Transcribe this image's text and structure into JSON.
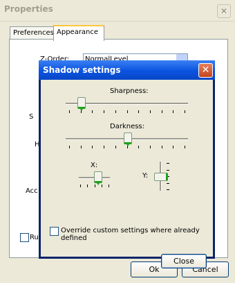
{
  "window": {
    "title": "Properties",
    "close_symbol": "✕"
  },
  "tabs": [
    {
      "label": "Preferences"
    },
    {
      "label": "Appearance"
    }
  ],
  "background": {
    "z_order_label": "Z-Order:",
    "z_order_value": "NormalLevel",
    "partial_label_s": "S",
    "partial_label_h": "H",
    "partial_label_acc": "Acc",
    "run_checkbox_label": "Run"
  },
  "buttons": {
    "ok": "Ok",
    "cancel": "Cancel"
  },
  "dialog": {
    "title": "Shadow settings",
    "close_symbol": "✕",
    "sharpness_label": "Sharpness:",
    "sharpness_value": 0.1,
    "darkness_label": "Darkness:",
    "darkness_value": 0.5,
    "x_label": "X:",
    "x_value": 0.6,
    "y_label": "Y:",
    "y_value": 0.5,
    "override_label": "Override custom settings where already defined",
    "override_checked": false,
    "close_button": "Close"
  }
}
